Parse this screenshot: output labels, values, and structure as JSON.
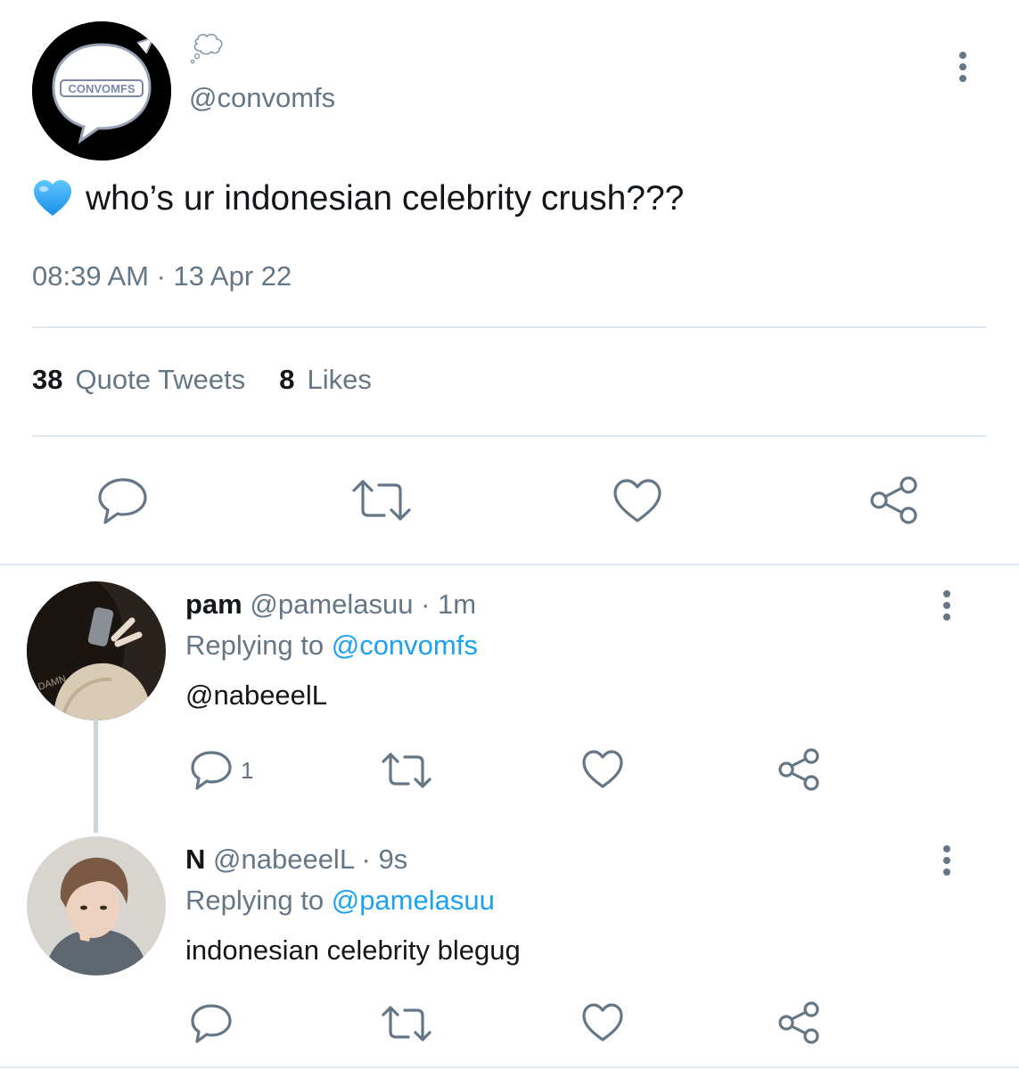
{
  "main_tweet": {
    "avatar_logo_text": "CONVOMFS",
    "emoji_icon": "thought-bubble-icon",
    "handle": "@convomfs",
    "text": "who’s ur indonesian celebrity crush???",
    "text_emoji": "blue-heart-icon",
    "timestamp": "08:39 AM · 13 Apr 22",
    "stats": {
      "quotes_count": "38",
      "quotes_label": "Quote Tweets",
      "likes_count": "8",
      "likes_label": "Likes"
    }
  },
  "replies": [
    {
      "name": "pam",
      "handle": "@pamelasuu",
      "time": "· 1m",
      "replying_label": "Replying to",
      "replying_to": "@convomfs",
      "body_mention": "@nabeeelL",
      "reply_count": "1"
    },
    {
      "name": "N",
      "handle": "@nabeeelL",
      "time": "· 9s",
      "replying_label": "Replying to",
      "replying_to": "@pamelasuu",
      "body": "indonesian celebrity blegug"
    }
  ],
  "colors": {
    "text": "#14171a",
    "secondary": "#657786",
    "link": "#1da1f2",
    "divider": "#e1e8ed"
  }
}
